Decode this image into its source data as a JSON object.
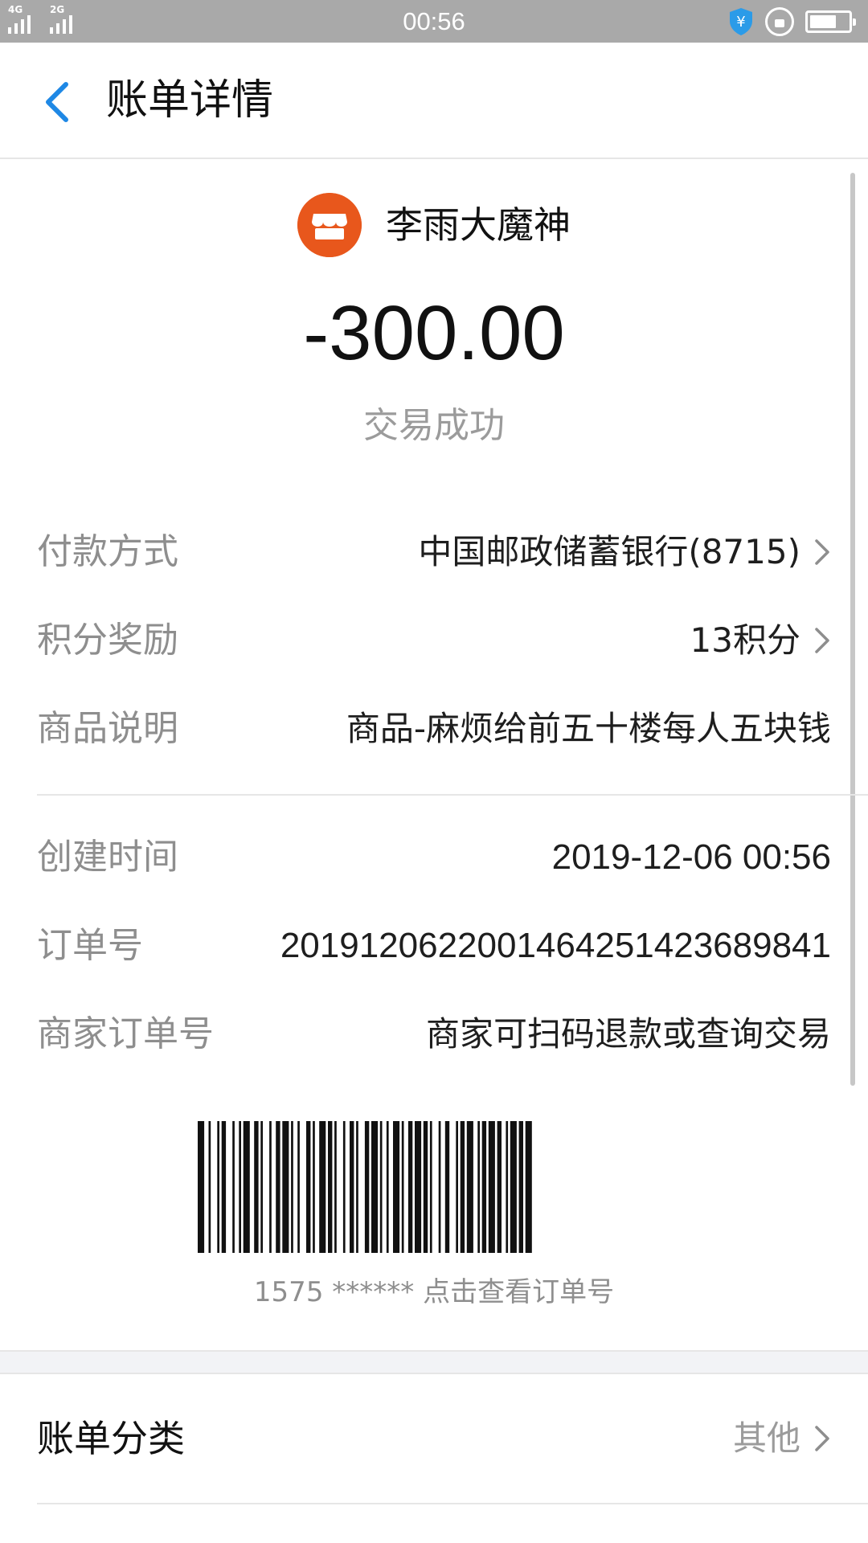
{
  "status_bar": {
    "time": "00:56",
    "signal1_label": "4G",
    "signal2_label": "2G",
    "battery_level": 0.7
  },
  "nav": {
    "title": "账单详情"
  },
  "merchant": {
    "name": "李雨大魔神",
    "icon": "store-icon",
    "icon_color": "#e8571c"
  },
  "amount": "-300.00",
  "status": "交易成功",
  "details": [
    {
      "label": "付款方式",
      "value": "中国邮政储蓄银行(8715)",
      "has_arrow": true
    },
    {
      "label": "积分奖励",
      "value": "13积分",
      "has_arrow": true
    },
    {
      "label": "商品说明",
      "value": "商品-麻烦给前五十楼每人五块钱",
      "has_arrow": false
    }
  ],
  "info": [
    {
      "label": "创建时间",
      "value": "2019-12-06 00:56"
    },
    {
      "label": "订单号",
      "value": "2019120622001464251423689841"
    },
    {
      "label": "商家订单号",
      "value": "商家可扫码退款或查询交易"
    }
  ],
  "barcode": {
    "caption": "1575 ****** 点击查看订单号"
  },
  "category": {
    "label": "账单分类",
    "value": "其他"
  },
  "colors": {
    "accent_blue": "#1e88e5",
    "muted_text": "#8e8e8e"
  }
}
